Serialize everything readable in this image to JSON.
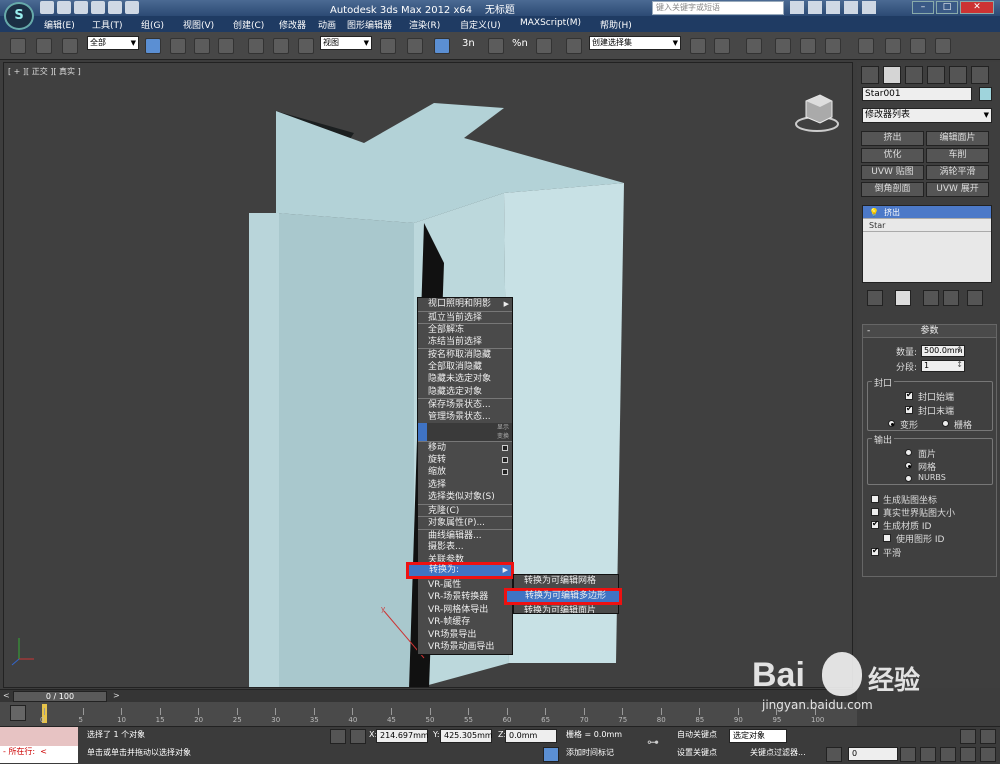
{
  "titlebar": {
    "app_title": "Autodesk 3ds Max  2012 x64",
    "file_name": "无标题",
    "search_placeholder": "键入关键字或短语"
  },
  "menubar": {
    "items": [
      "编辑(E)",
      "工具(T)",
      "组(G)",
      "视图(V)",
      "创建(C)",
      "修改器",
      "动画",
      "图形编辑器",
      "渲染(R)",
      "自定义(U)",
      "MAXScript(M)",
      "帮助(H)"
    ]
  },
  "toolbar": {
    "selection_filter": "全部",
    "reference_coord": "视图",
    "named_selection": "创建选择集",
    "snap_labels": [
      "3n",
      "%n"
    ]
  },
  "viewport": {
    "label": "[ + ][ 正交 ][ 真实 ]"
  },
  "context_menu": {
    "items": [
      {
        "label": "视口照明和阴影",
        "arrow": true
      },
      {
        "label": "孤立当前选择",
        "sep": true
      },
      {
        "label": "全部解冻",
        "sep": true
      },
      {
        "label": "冻结当前选择"
      },
      {
        "label": "按名称取消隐藏",
        "sep": true
      },
      {
        "label": "全部取消隐藏"
      },
      {
        "label": "隐藏未选定对象"
      },
      {
        "label": "隐藏选定对象"
      },
      {
        "label": "保存场景状态...",
        "sep": true
      },
      {
        "label": "管理场景状态..."
      }
    ],
    "quad_labels": [
      "显示",
      "变换"
    ],
    "transform_items": [
      {
        "label": "移动",
        "box": true,
        "sep": true
      },
      {
        "label": "旋转",
        "box": true
      },
      {
        "label": "缩放",
        "box": true
      },
      {
        "label": "选择"
      },
      {
        "label": "选择类似对象(S)"
      },
      {
        "label": "克隆(C)",
        "sep": true
      },
      {
        "label": "对象属性(P)...",
        "sep": true
      },
      {
        "label": "曲线编辑器...",
        "sep": true
      },
      {
        "label": "摄影表..."
      },
      {
        "label": "关联参数"
      },
      {
        "label": "转换为:",
        "arrow": true,
        "hl": true
      },
      {
        "label": "VR-属性"
      },
      {
        "label": "VR-场景转换器"
      },
      {
        "label": "VR-网格体导出"
      },
      {
        "label": "VR-帧缓存"
      },
      {
        "label": "VR场景导出"
      },
      {
        "label": "VR场景动画导出"
      }
    ]
  },
  "submenu": {
    "items": [
      {
        "label": "转换为可编辑网格"
      },
      {
        "label": "转换为可编辑多边形",
        "hl": true
      },
      {
        "label": "转换为可编辑面片"
      }
    ]
  },
  "right_panel": {
    "object_name": "Star001",
    "object_color": "#9fd4dc",
    "modifier_list": "修改器列表",
    "modifier_buttons": [
      "挤出",
      "编辑面片",
      "优化",
      "车削",
      "UVW 贴图",
      "涡轮平滑",
      "倒角剖面",
      "UVW 展开"
    ],
    "stack": [
      "挤出",
      "Star"
    ],
    "params": {
      "title": "参数",
      "amount_label": "数量:",
      "amount": "500.0mm",
      "segments_label": "分段:",
      "segments": "1",
      "capping_title": "封口",
      "cap_start": "封口始端",
      "cap_end": "封口末端",
      "morph": "变形",
      "grid": "栅格",
      "output_title": "输出",
      "out_patch": "面片",
      "out_mesh": "网格",
      "out_nurbs": "NURBS",
      "gen_map_coords": "生成贴图坐标",
      "real_world_map": "真实世界贴图大小",
      "gen_mat_ids": "生成材质 ID",
      "use_shape_ids": "使用图形 ID",
      "smooth": "平滑"
    }
  },
  "timeslider": {
    "frame": "0 / 100"
  },
  "trackbar": {
    "ticks": [
      "0",
      "5",
      "10",
      "15",
      "20",
      "25",
      "30",
      "35",
      "40",
      "45",
      "50",
      "55",
      "60",
      "65",
      "70",
      "75",
      "80",
      "85",
      "90",
      "95",
      "100"
    ]
  },
  "statusbar": {
    "selected": "选择了 1 个对象",
    "prompt": "单击或单击并拖动以选择对象",
    "now_label": "所在行:",
    "x_label": "X:",
    "x": "214.697mm",
    "y_label": "Y:",
    "y": "425.305mm",
    "z_label": "Z:",
    "z": "0.0mm",
    "grid": "栅格 = 0.0mm",
    "add_time_tag": "添加时间标记",
    "auto_key": "自动关键点",
    "set_key": "设置关键点",
    "selected_obj": "选定对象",
    "key_filters": "关键点过滤器...",
    "frame_input": "0"
  },
  "watermark": {
    "brand": "Bai",
    "brand2": "经验",
    "url": "jingyan.baidu.com"
  }
}
